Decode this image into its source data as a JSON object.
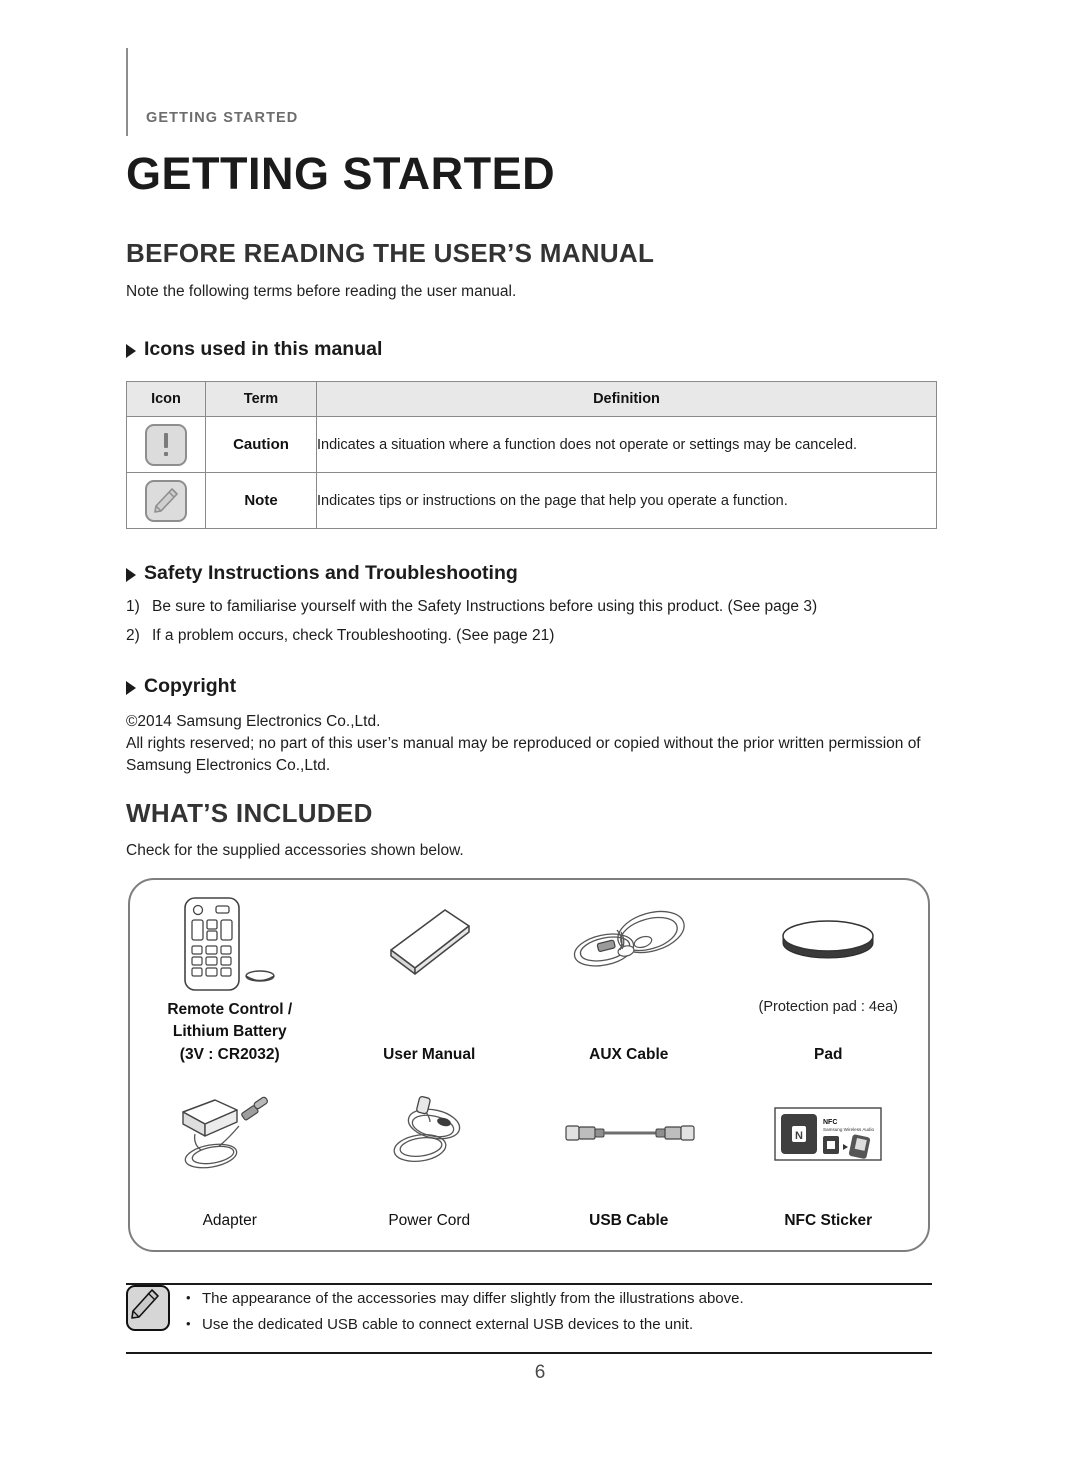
{
  "header": {
    "kicker": "GETTING STARTED",
    "chapter_title": "GETTING STARTED"
  },
  "before_reading": {
    "heading": "BEFORE READING THE USER’S MANUAL",
    "intro": "Note the following terms before reading the user manual.",
    "sub_icons": "Icons used in this manual",
    "table": {
      "columns": [
        "Icon",
        "Term",
        "Definition"
      ],
      "rows": [
        {
          "icon": "caution-icon",
          "term": "Caution",
          "definition": "Indicates a situation where a function does not operate or settings may be canceled."
        },
        {
          "icon": "note-icon",
          "term": "Note",
          "definition": "Indicates tips or instructions on the page that help you operate a function."
        }
      ]
    },
    "sub_safety": "Safety Instructions and Troubleshooting",
    "safety_items": [
      {
        "marker": "1)",
        "text": "Be sure to familiarise yourself with the Safety Instructions before using this product. (See page 3)"
      },
      {
        "marker": "2)",
        "text": "If a problem occurs, check Troubleshooting. (See page 21)"
      }
    ],
    "sub_copyright": "Copyright",
    "copyright_lines": [
      "©2014 Samsung Electronics Co.,Ltd.",
      "All rights reserved; no part of this user’s manual may be reproduced or copied without the prior written permission of Samsung Electronics Co.,Ltd."
    ]
  },
  "whats_included": {
    "heading": "WHAT’S INCLUDED",
    "intro": "Check for the supplied accessories shown below.",
    "accessories": [
      {
        "art": "remote-control-and-battery",
        "label": "Remote Control /\nLithium Battery\n(3V : CR2032)",
        "sub": ""
      },
      {
        "art": "user-manual-booklet",
        "label": "User Manual",
        "sub": ""
      },
      {
        "art": "aux-cable-coiled",
        "label": "AUX Cable",
        "sub": ""
      },
      {
        "art": "protection-pad-disc",
        "label": "Pad",
        "sub": "(Protection pad : 4ea)"
      },
      {
        "art": "power-adapter",
        "label": "Adapter",
        "sub": ""
      },
      {
        "art": "power-cord-coiled",
        "label": "Power Cord",
        "sub": ""
      },
      {
        "art": "usb-cable",
        "label": "USB Cable",
        "sub": ""
      },
      {
        "art": "nfc-sticker",
        "label": "NFC Sticker",
        "sub": ""
      }
    ],
    "nfc_sticker_text": {
      "title": "NFC",
      "subtitle": "Samsung Wireless Audio"
    }
  },
  "footnote": {
    "icon": "note-icon",
    "bullet_char": "•",
    "items": [
      "The appearance of the accessories may differ slightly from the illustrations above.",
      "Use the dedicated USB cable to connect external USB devices to the unit."
    ]
  },
  "page_number": "6",
  "colors": {
    "text": "#1a1a1a",
    "kicker": "#6d6d6d",
    "heading": "#333333",
    "table_header_bg": "#e8e8e8",
    "rule": "#8a8a8a",
    "box_border": "#7e7e7e"
  }
}
